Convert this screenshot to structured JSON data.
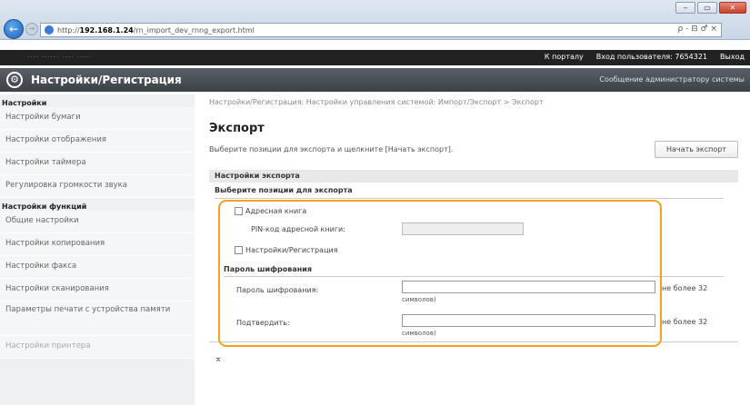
{
  "browser": {
    "url_prefix": "http://",
    "url_host": "192.168.1.24",
    "url_path": "/rn_import_dev_rnng_export.html",
    "tools": "ρ - ⊟ ♂ ×",
    "window_buttons": [
      "‒",
      "▭",
      "✕"
    ],
    "toolbar_icons": "⌂ ☆ ⚙"
  },
  "device_bar": {
    "device_name": "···· ······ ···· ·····",
    "portal_link": "К порталу",
    "login_info": "Вход пользователя: 7654321",
    "logout": "Выход"
  },
  "header": {
    "title": "Настройки/Регистрация",
    "message": "Сообщение администратору системы"
  },
  "sidebar": {
    "group1": "Настройки",
    "group1_items": [
      "Настройки бумаги",
      "Настройки отображения",
      "Настройки таймера",
      "Регулировка громкости звука"
    ],
    "group2": "Настройки функций",
    "group2_items": [
      "Общие настройки",
      "Настройки копирования",
      "Настройки факса",
      "Настройки сканирования",
      "Параметры печати с устройства памяти",
      "Настройки принтера"
    ]
  },
  "main": {
    "breadcrumb": "Настройки/Регистрация: Настройки управления системой: Импорт/Экспорт > Экспорт",
    "title": "Экспорт",
    "hint": "Выберите позиции для экспорта и щелкните [Начать экспорт].",
    "start_button": "Начать экспорт",
    "section_title": "Настройки экспорта",
    "select_title": "Выберите позиции для экспорта",
    "address_book_label": "Адресная книга",
    "pin_label": "PIN-код адресной книги:",
    "settings_label": "Настройки/Регистрация",
    "encryption_title": "Пароль шифрования",
    "password_label": "Пароль шифрования:",
    "confirm_label": "Подтвердить:",
    "max_note": "не более 32",
    "chars_note": "символов)",
    "top_link": "⌅"
  }
}
